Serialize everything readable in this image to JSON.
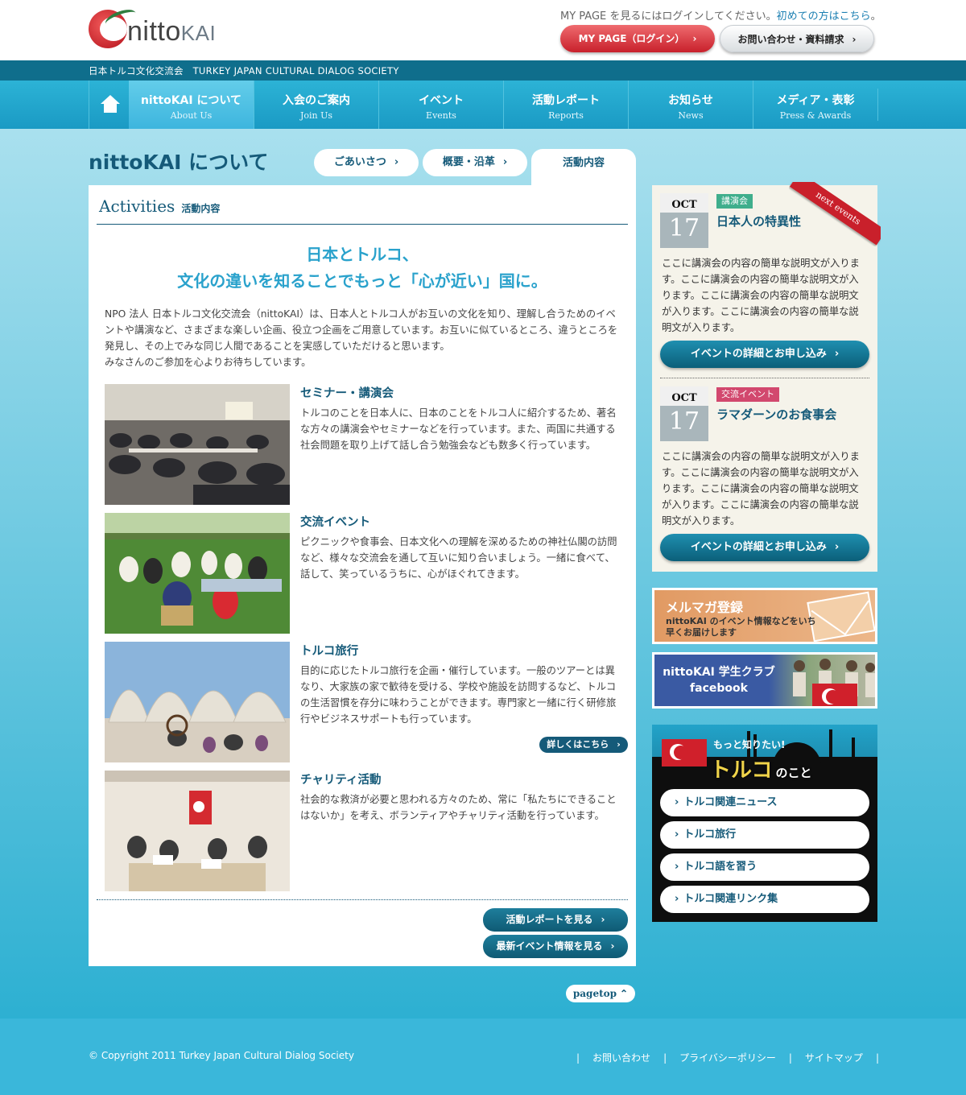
{
  "header": {
    "logo_main": "nitto",
    "logo_sub": "KAI",
    "login_note": "MY PAGE を見るにはログインしてください。",
    "login_note_link": "初めての方はこちら",
    "login_note_end": "。",
    "mypage_button": "MY PAGE（ログイン）",
    "contact_button": "お問い合わせ・資料請求"
  },
  "subbar": {
    "text": "日本トルコ文化交流会　TURKEY JAPAN CULTURAL DIALOG SOCIETY"
  },
  "nav": {
    "items": [
      {
        "jp": "nittoKAI について",
        "en": "About Us"
      },
      {
        "jp": "入会のご案内",
        "en": "Join Us"
      },
      {
        "jp": "イベント",
        "en": "Events"
      },
      {
        "jp": "活動レポート",
        "en": "Reports"
      },
      {
        "jp": "お知らせ",
        "en": "News"
      },
      {
        "jp": "メディア・表彰",
        "en": "Press & Awards"
      }
    ]
  },
  "page": {
    "title": "nittoKAI について",
    "tabs": [
      "ごあいさつ",
      "概要・沿革",
      "活動内容"
    ]
  },
  "main": {
    "section_title": "Activities",
    "section_title_jp": "活動内容",
    "lead_line1": "日本とトルコ、",
    "lead_line2": "文化の違いを知ることでもっと「心が近い」国に。",
    "intro": "NPO 法人 日本トルコ文化交流会（nittoKAI）は、日本人とトルコ人がお互いの文化を知り、理解し合うためのイベントや講演など、さまざまな楽しい企画、役立つ企画をご用意しています。お互いに似ているところ、違うところを発見し、その上でみな同じ人間であることを実感していただけると思います。",
    "intro2": "みなさんのご参加を心よりお待ちしています。",
    "activities": [
      {
        "title": "セミナー・講演会",
        "text": "トルコのことを日本人に、日本のことをトルコ人に紹介するため、著名な方々の講演会やセミナーなどを行っています。また、両国に共通する社会問題を取り上げて話し合う勉強会なども数多く行っています。"
      },
      {
        "title": "交流イベント",
        "text": "ピクニックや食事会、日本文化への理解を深めるための神社仏閣の訪問など、様々な交流会を通して互いに知り合いましょう。一緒に食べて、話して、笑っているうちに、心がほぐれてきます。"
      },
      {
        "title": "トルコ旅行",
        "text": "目的に応じたトルコ旅行を企画・催行しています。一般のツアーとは異なり、大家族の家で歓待を受ける、学校や施設を訪問するなど、トルコの生活習慣を存分に味わうことができます。専門家と一緒に行く研修旅行やビジネスサポートも行っています。"
      },
      {
        "title": "チャリティ活動",
        "text": "社会的な救済が必要と思われる方々のため、常に「私たちにできることはないか」を考え、ボランティアやチャリティ活動を行っています。"
      }
    ],
    "more_button": "詳しくはこちら",
    "report_button": "活動レポートを見る",
    "event_button": "最新イベント情報を見る"
  },
  "pagetop": "pagetop",
  "events": {
    "ribbon": "next events",
    "items": [
      {
        "month": "OCT",
        "day": "17",
        "tag": "講演会",
        "tag_color": "#3fae8c",
        "title": "日本人の特異性",
        "desc": "ここに講演会の内容の簡単な説明文が入ります。ここに講演会の内容の簡単な説明文が入ります。ここに講演会の内容の簡単な説明文が入ります。ここに講演会の内容の簡単な説明文が入ります。",
        "button": "イベントの詳細とお申し込み"
      },
      {
        "month": "OCT",
        "day": "17",
        "tag": "交流イベント",
        "tag_color": "#d2486e",
        "title": "ラマダーンのお食事会",
        "desc": "ここに講演会の内容の簡単な説明文が入ります。ここに講演会の内容の簡単な説明文が入ります。ここに講演会の内容の簡単な説明文が入ります。ここに講演会の内容の簡単な説明文が入ります。",
        "button": "イベントの詳細とお申し込み"
      }
    ]
  },
  "banners": {
    "mail_title": "メルマガ登録",
    "mail_text": "nittoKAI のイベント情報などをいち早くお届けします",
    "fb_line1": "nittoKAI 学生クラブ",
    "fb_line2": "facebook"
  },
  "turkey": {
    "small": "もっと知りたい!",
    "big": "トルコ",
    "big_suffix": "のこと",
    "links": [
      "トルコ関連ニュース",
      "トルコ旅行",
      "トルコ語を習う",
      "トルコ関連リンク集"
    ]
  },
  "footer": {
    "copyright": "© Copyright 2011 Turkey Japan Cultural Dialog Society",
    "links": [
      "お問い合わせ",
      "プライバシーポリシー",
      "サイトマップ"
    ]
  },
  "colors": {
    "brand": "#155a79",
    "accent": "#2aa2cc",
    "nav": "#1a9ac4",
    "mypage": "#c8202b"
  }
}
